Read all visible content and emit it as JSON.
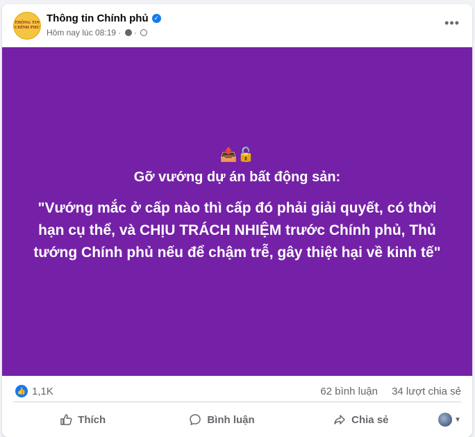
{
  "post": {
    "page_name": "Thông tin Chính phủ",
    "avatar_text_line1": "THÔNG TIN",
    "avatar_text_line2": "CHÍNH PHỦ",
    "timestamp": "Hôm nay lúc 08:19",
    "separator": "·",
    "image": {
      "background_color": "#7421a7",
      "emoji": "📤🔓",
      "headline": "Gỡ vướng dự án bất động sản:",
      "quote": "\"Vướng mắc ở cấp nào thì cấp đó phải giải quyết, có thời hạn cụ thể, và CHỊU TRÁCH NHIỆM trước Chính phủ, Thủ tướng Chính phủ nếu để chậm trễ, gây thiệt hại về kinh tế\""
    }
  },
  "stats": {
    "reactions": "1,1K",
    "comments": "62 bình luận",
    "shares": "34 lượt chia sẻ"
  },
  "actions": {
    "like": "Thích",
    "comment": "Bình luận",
    "share": "Chia sẻ"
  },
  "colors": {
    "accent": "#1877f2",
    "secondary_text": "#65676b"
  }
}
